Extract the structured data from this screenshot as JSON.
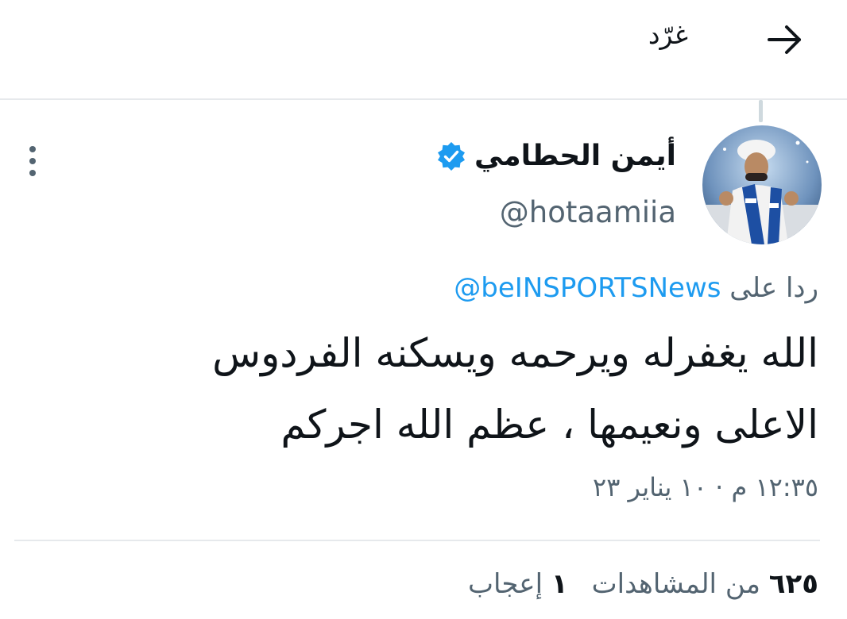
{
  "header": {
    "title": "غرّد",
    "back_icon": "arrow-right-icon"
  },
  "tweet": {
    "display_name": "أيمن الحطامي",
    "handle": "@hotaamiia",
    "verified_icon": "verified-badge-icon",
    "verified_color": "#1d9bf0",
    "more_icon": "more-vertical-icon",
    "reply_prefix": "ردا على",
    "reply_to": "@beINSPORTSNews",
    "text_line1": "الله يغفرله ويرحمه ويسكنه الفردوس",
    "text_line2": "الاعلى ونعيمها ، عظم الله اجركم",
    "meta": "١٢:٣٥ م · ١٠ يناير ٢٣"
  },
  "stats": {
    "views_count": "٦٢٥",
    "views_label": "من المشاهدات",
    "likes_count": "١",
    "likes_label": "إعجاب"
  },
  "colors": {
    "accent": "#1d9bf0",
    "text": "#0f1419",
    "secondary": "#536471",
    "divider": "#e6e9ec"
  }
}
